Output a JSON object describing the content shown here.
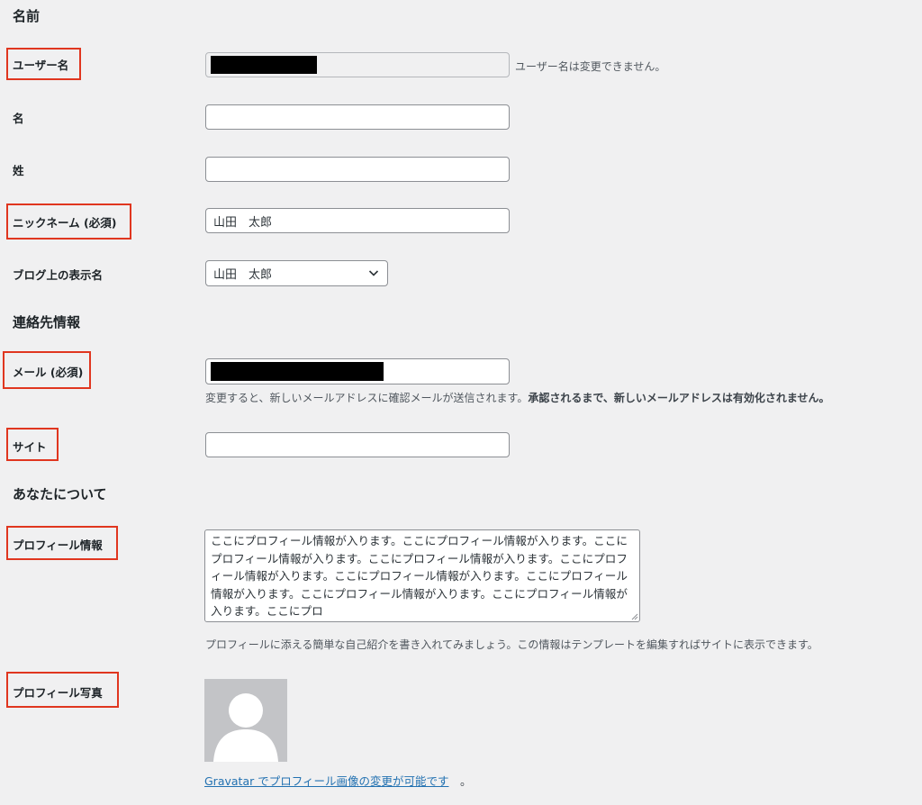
{
  "sections": {
    "name": "名前",
    "contact": "連絡先情報",
    "about": "あなたについて"
  },
  "fields": {
    "username": {
      "label": "ユーザー名",
      "note": "ユーザー名は変更できません。"
    },
    "first_name": {
      "label": "名",
      "value": ""
    },
    "last_name": {
      "label": "姓",
      "value": ""
    },
    "nickname": {
      "label": "ニックネーム (必須)",
      "value": "山田　太郎"
    },
    "display_name": {
      "label": "ブログ上の表示名",
      "selected": "山田　太郎"
    },
    "email": {
      "label": "メール (必須)",
      "note_normal": "変更すると、新しいメールアドレスに確認メールが送信されます。",
      "note_bold": "承認されるまで、新しいメールアドレスは有効化されません。"
    },
    "site": {
      "label": "サイト",
      "value": ""
    },
    "bio": {
      "label": "プロフィール情報",
      "value": "ここにプロフィール情報が入ります。ここにプロフィール情報が入ります。ここにプロフィール情報が入ります。ここにプロフィール情報が入ります。ここにプロフィール情報が入ります。ここにプロフィール情報が入ります。ここにプロフィール情報が入ります。ここにプロフィール情報が入ります。ここにプロフィール情報が入ります。ここにプロ",
      "note": "プロフィールに添える簡単な自己紹介を書き入れてみましょう。この情報はテンプレートを編集すればサイトに表示できます。"
    },
    "photo": {
      "label": "プロフィール写真",
      "link": "Gravatar でプロフィール画像の変更が可能です",
      "link_suffix": "。"
    }
  },
  "colors": {
    "highlight": "#e0361f",
    "link": "#2271b1",
    "background": "#f0f0f1"
  },
  "icons": {
    "select": "chevron-down-icon",
    "textarea": "resize-handle-icon",
    "avatar": "default-avatar-icon"
  }
}
